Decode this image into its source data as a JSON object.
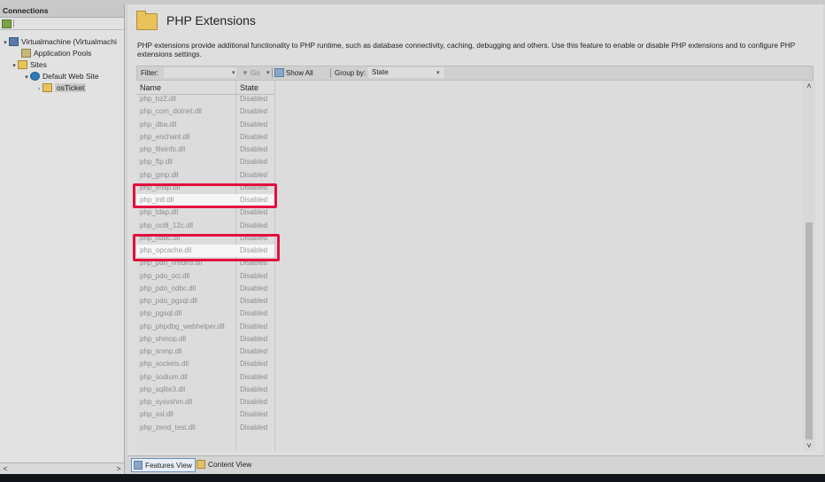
{
  "left_pane": {
    "header": "Connections",
    "tree": [
      {
        "label": "Virtualmachine (Virtualmachi",
        "icon": "computer-icon"
      },
      {
        "label": "Application Pools",
        "icon": "app-pool-icon"
      },
      {
        "label": "Sites",
        "icon": "sites-folder-icon"
      },
      {
        "label": "Default Web Site",
        "icon": "globe-icon"
      },
      {
        "label": "osTicket",
        "icon": "folder-icon"
      }
    ],
    "scroll_left": "<",
    "scroll_right": ">"
  },
  "main": {
    "title": "PHP Extensions",
    "description": "PHP extensions provide additional functionality to PHP runtime, such as database connectivity, caching, debugging and others. Use this feature to enable or disable PHP extensions and to configure PHP extensions settings."
  },
  "filterbar": {
    "filter_label": "Filter:",
    "filter_value": "",
    "go_label": "Go",
    "show_all_label": "Show All",
    "group_by_label": "Group by:",
    "group_by_value": "State"
  },
  "list": {
    "col_name": "Name",
    "col_state": "State",
    "rows": [
      {
        "name": "php_bz2.dll",
        "state": "Disabled"
      },
      {
        "name": "php_com_dotnet.dll",
        "state": "Disabled"
      },
      {
        "name": "php_dba.dll",
        "state": "Disabled"
      },
      {
        "name": "php_enchant.dll",
        "state": "Disabled"
      },
      {
        "name": "php_fileinfo.dll",
        "state": "Disabled"
      },
      {
        "name": "php_ftp.dll",
        "state": "Disabled"
      },
      {
        "name": "php_gmp.dll",
        "state": "Disabled"
      },
      {
        "name": "php_imap.dll",
        "state": "Disabled"
      },
      {
        "name": "php_intl.dll",
        "state": "Disabled"
      },
      {
        "name": "php_ldap.dll",
        "state": "Disabled"
      },
      {
        "name": "php_oci8_12c.dll",
        "state": "Disabled"
      },
      {
        "name": "php_odbc.dll",
        "state": "Disabled"
      },
      {
        "name": "php_opcache.dll",
        "state": "Disabled"
      },
      {
        "name": "php_pdo_firebird.dll",
        "state": "Disabled"
      },
      {
        "name": "php_pdo_oci.dll",
        "state": "Disabled"
      },
      {
        "name": "php_pdo_odbc.dll",
        "state": "Disabled"
      },
      {
        "name": "php_pdo_pgsql.dll",
        "state": "Disabled"
      },
      {
        "name": "php_pgsql.dll",
        "state": "Disabled"
      },
      {
        "name": "php_phpdbg_webhelper.dll",
        "state": "Disabled"
      },
      {
        "name": "php_shmop.dll",
        "state": "Disabled"
      },
      {
        "name": "php_snmp.dll",
        "state": "Disabled"
      },
      {
        "name": "php_sockets.dll",
        "state": "Disabled"
      },
      {
        "name": "php_sodium.dll",
        "state": "Disabled"
      },
      {
        "name": "php_sqlite3.dll",
        "state": "Disabled"
      },
      {
        "name": "php_sysvshm.dll",
        "state": "Disabled"
      },
      {
        "name": "php_xsl.dll",
        "state": "Disabled"
      },
      {
        "name": "php_zend_test.dll",
        "state": "Disabled"
      }
    ],
    "highlighted": [
      "php_intl.dll",
      "php_opcache.dll"
    ]
  },
  "bottom_tabs": {
    "features_view": "Features View",
    "content_view": "Content View"
  },
  "colors": {
    "highlight_box": "#e3103e",
    "disabled_text": "#8c8c8c"
  }
}
